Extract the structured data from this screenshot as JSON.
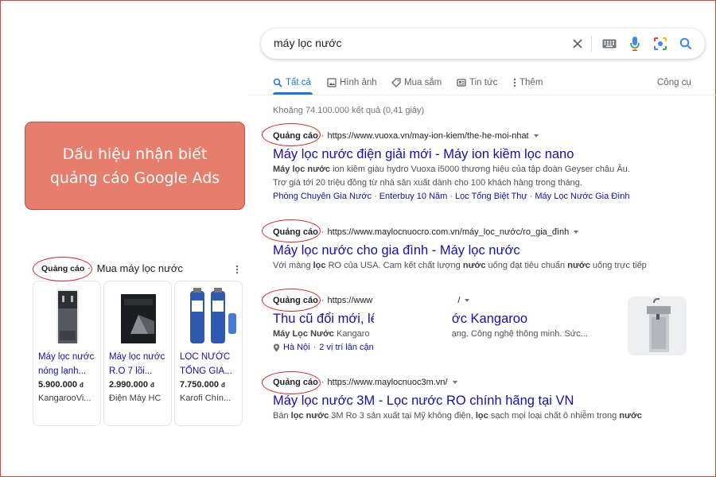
{
  "search": {
    "query": "máy lọc nước",
    "icons": [
      "close-icon",
      "keyboard-icon",
      "mic-icon",
      "lens-icon",
      "search-icon"
    ]
  },
  "tabs": [
    {
      "label": "Tất cả",
      "icon": "search-icon",
      "active": true
    },
    {
      "label": "Hình ảnh",
      "icon": "image-icon"
    },
    {
      "label": "Mua sắm",
      "icon": "tag-icon"
    },
    {
      "label": "Tin tức",
      "icon": "news-icon"
    },
    {
      "label": "Thêm",
      "icon": "more-vert-icon"
    }
  ],
  "tools_label": "Công cụ",
  "result_stats": "Khoảng 74.100.000 kết quả (0,41 giây)",
  "ad_label": "Quảng cáo",
  "results": [
    {
      "url": "https://www.vuoxa.vn/may-ion-kiem/the-he-moi-nhat",
      "title": "Máy lọc nước điện giải mới - Máy ion kiềm lọc nano",
      "desc1_bold": "Máy lọc nước",
      "desc1_rest": " ion kiềm giàu hydro Vuoxa i5000 thương hiệu của tập đoàn Geyser châu Âu.",
      "desc2": "Trợ giá tới 20 triệu đồng từ nhà sản xuất dành cho 100 khách hàng trong tháng.",
      "sitelinks": [
        "Phòng Chuyên Gia Nước",
        "Enterbuy 10 Năm",
        "Lọc Tổng Biệt Thự",
        "Máy Lọc Nước Gia Đình"
      ]
    },
    {
      "url": "https://www.maylocnuocro.com.vn/máy_lọc_nước/ro_gia_đình",
      "title": "Máy lọc nước cho gia đình - Máy lọc nước",
      "desc_a": "Với màng ",
      "desc_b": "lọc",
      "desc_c": " RO của USA. Cam kết chất lượng ",
      "desc_d": "nước",
      "desc_e": " uống đạt tiêu chuẩn ",
      "desc_f": "nước",
      "desc_g": " uống trực tiếp"
    },
    {
      "url_left": "https://www",
      "url_right": "/",
      "title_left": "Thu cũ đổi mới, lê",
      "title_right": "ớc Kangaroo",
      "desc_bold": "Máy Lọc Nước",
      "desc_left_rest": " Kangaro",
      "desc_right": "ạng. Công nghệ thông minh. Sức...",
      "location": "Hà Nội",
      "branches": "2 vị trí lân cận"
    },
    {
      "url": "https://www.maylocnuoc3m.vn/",
      "title": "Máy lọc nước 3M - Lọc nước RO chính hãng tại VN",
      "desc_a": "Bán ",
      "desc_b": "lọc nước",
      "desc_c": " 3M Ro 3 sản xuất tại Mỹ không điện, ",
      "desc_d": "lọc",
      "desc_e": " sạch mọi loại chất ô nhiễm trong ",
      "desc_f": "nước"
    }
  ],
  "callout": {
    "line1": "Dấu hiệu nhận biết",
    "line2": "quảng cáo Google Ads"
  },
  "shopping": {
    "heading": "Mua máy lọc nước",
    "currency": "đ",
    "products": [
      {
        "name": "Máy lọc nước nóng lạnh...",
        "price": "5.900.000",
        "seller": "KangarooVi..."
      },
      {
        "name": "Máy lọc nước R.O 7 lõi...",
        "price": "2.990.000",
        "seller": "Điện Máy HC"
      },
      {
        "name": "LỌC NƯỚC TỔNG GIA...",
        "price": "7.750.000",
        "seller": "Karofi Chín..."
      }
    ]
  },
  "colors": {
    "link": "#1a0dab",
    "accent": "#1a73e8",
    "callout_bg": "#e67d6d",
    "annotation": "#d9232e"
  }
}
